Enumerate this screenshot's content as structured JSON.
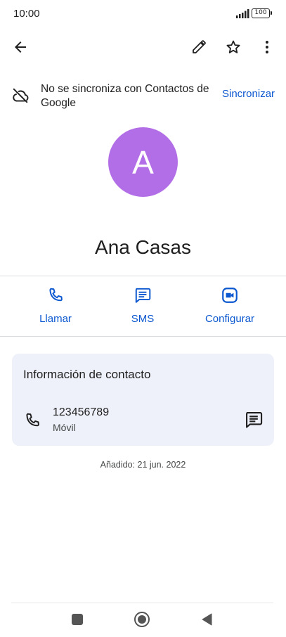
{
  "status_bar": {
    "time": "10:00",
    "battery": "100"
  },
  "toolbar": {
    "back_icon": "arrow-back-icon",
    "edit_icon": "pencil-icon",
    "favorite_icon": "star-outline-icon",
    "more_icon": "more-vert-icon"
  },
  "sync_banner": {
    "icon": "cloud-off-icon",
    "message": "No se sincroniza con Contactos de Google",
    "action_label": "Sincronizar"
  },
  "contact": {
    "avatar_letter": "A",
    "avatar_color": "#b26ee6",
    "name": "Ana Casas"
  },
  "actions": [
    {
      "label": "Llamar",
      "icon": "phone-icon"
    },
    {
      "label": "SMS",
      "icon": "message-icon"
    },
    {
      "label": "Configurar",
      "icon": "video-call-icon"
    }
  ],
  "contact_info": {
    "title": "Información de contacto",
    "phone": {
      "number": "123456789",
      "type": "Móvil"
    }
  },
  "added": "Añadido: 21 jun. 2022",
  "colors": {
    "accent": "#0b57d0",
    "card_background": "#eef1f9",
    "text": "#1f1f1f"
  }
}
